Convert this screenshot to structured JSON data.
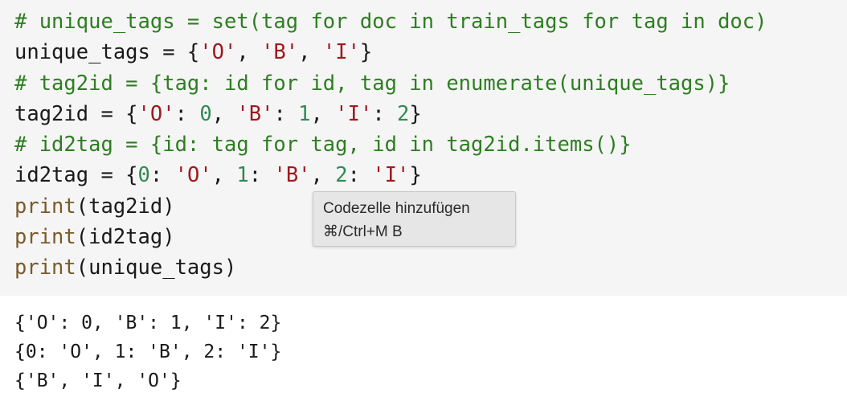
{
  "code_cell": {
    "lines": [
      [
        {
          "t": "# unique_tags = set(tag for doc in train_tags for tag in doc)",
          "k": "comment"
        }
      ],
      [
        {
          "t": "unique_tags = {",
          "k": "plain"
        },
        {
          "t": "'O'",
          "k": "string"
        },
        {
          "t": ", ",
          "k": "plain"
        },
        {
          "t": "'B'",
          "k": "string"
        },
        {
          "t": ", ",
          "k": "plain"
        },
        {
          "t": "'I'",
          "k": "string"
        },
        {
          "t": "}",
          "k": "plain"
        }
      ],
      [
        {
          "t": "# tag2id = {tag: id for id, tag in enumerate(unique_tags)}",
          "k": "comment"
        }
      ],
      [
        {
          "t": "tag2id = {",
          "k": "plain"
        },
        {
          "t": "'O'",
          "k": "string"
        },
        {
          "t": ": ",
          "k": "plain"
        },
        {
          "t": "0",
          "k": "number"
        },
        {
          "t": ", ",
          "k": "plain"
        },
        {
          "t": "'B'",
          "k": "string"
        },
        {
          "t": ": ",
          "k": "plain"
        },
        {
          "t": "1",
          "k": "number"
        },
        {
          "t": ", ",
          "k": "plain"
        },
        {
          "t": "'I'",
          "k": "string"
        },
        {
          "t": ": ",
          "k": "plain"
        },
        {
          "t": "2",
          "k": "number"
        },
        {
          "t": "}",
          "k": "plain"
        }
      ],
      [
        {
          "t": "# id2tag = {id: tag for tag, id in tag2id.items()}",
          "k": "comment"
        }
      ],
      [
        {
          "t": "id2tag = {",
          "k": "plain"
        },
        {
          "t": "0",
          "k": "number"
        },
        {
          "t": ": ",
          "k": "plain"
        },
        {
          "t": "'O'",
          "k": "string"
        },
        {
          "t": ", ",
          "k": "plain"
        },
        {
          "t": "1",
          "k": "number"
        },
        {
          "t": ": ",
          "k": "plain"
        },
        {
          "t": "'B'",
          "k": "string"
        },
        {
          "t": ", ",
          "k": "plain"
        },
        {
          "t": "2",
          "k": "number"
        },
        {
          "t": ": ",
          "k": "plain"
        },
        {
          "t": "'I'",
          "k": "string"
        },
        {
          "t": "}",
          "k": "plain"
        }
      ],
      [
        {
          "t": "print",
          "k": "builtin"
        },
        {
          "t": "(tag2id)",
          "k": "plain"
        }
      ],
      [
        {
          "t": "print",
          "k": "builtin"
        },
        {
          "t": "(id2tag)",
          "k": "plain"
        }
      ],
      [
        {
          "t": "print",
          "k": "builtin"
        },
        {
          "t": "(unique_tags)",
          "k": "plain"
        }
      ]
    ]
  },
  "output": {
    "lines": [
      "{'O': 0, 'B': 1, 'I': 2}",
      "{0: 'O', 1: 'B', 2: 'I'}",
      "{'B', 'I', 'O'}"
    ]
  },
  "tooltip": {
    "title": "Codezelle hinzufügen",
    "shortcut": "⌘/Ctrl+M B"
  },
  "colors": {
    "comment": "#2e7d22",
    "string": "#a0181e",
    "number": "#2f8a52",
    "builtin": "#7a5a2a",
    "cell_background": "#f5f5f5",
    "tooltip_background": "#e6e6e6"
  }
}
